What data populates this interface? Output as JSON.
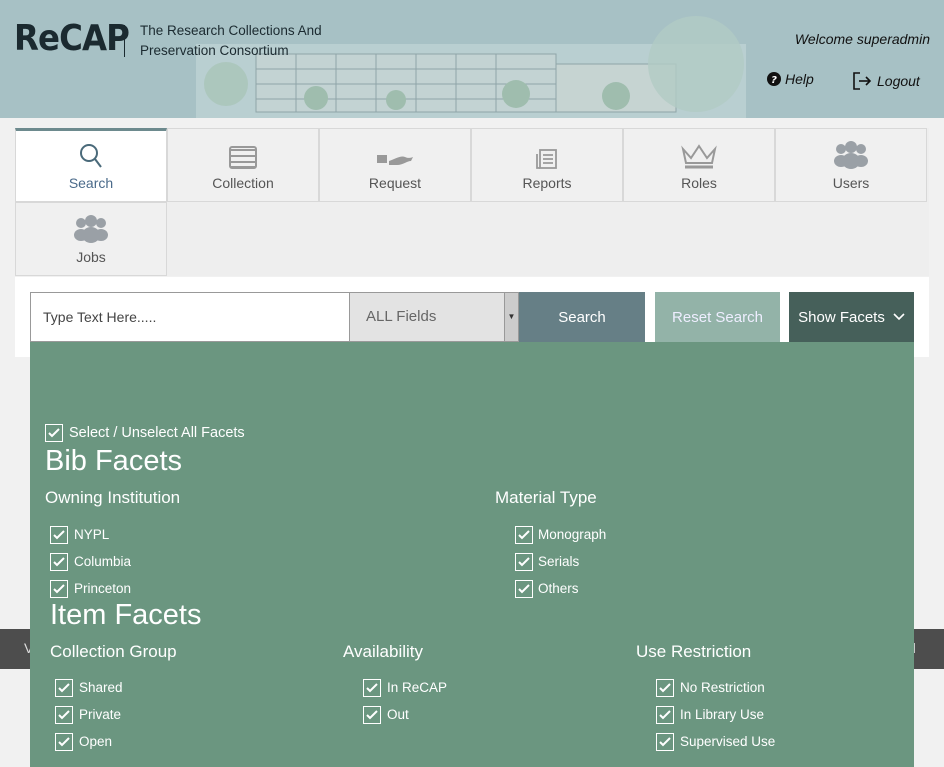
{
  "header": {
    "logo": "ReCAP",
    "tagline": "The Research Collections And Preservation Consortium",
    "welcome": "Welcome superadmin",
    "help": "Help",
    "logout": "Logout"
  },
  "tabs": [
    {
      "label": "Search",
      "icon": "search-icon",
      "active": true
    },
    {
      "label": "Collection",
      "icon": "books-icon"
    },
    {
      "label": "Request",
      "icon": "hand-book-icon"
    },
    {
      "label": "Reports",
      "icon": "document-icon"
    },
    {
      "label": "Roles",
      "icon": "crown-icon"
    },
    {
      "label": "Users",
      "icon": "users-icon"
    },
    {
      "label": "Jobs",
      "icon": "users-icon"
    }
  ],
  "search": {
    "placeholder": "Type Text Here.....",
    "field": "ALL Fields",
    "search_label": "Search",
    "reset_label": "Reset Search",
    "show_facets_label": "Show Facets"
  },
  "footer": {
    "left": "V",
    "right": "d"
  },
  "facets": {
    "select_all": "Select / Unselect All Facets",
    "bib_title": "Bib Facets",
    "owning_institution": {
      "title": "Owning Institution",
      "items": [
        "NYPL",
        "Columbia",
        "Princeton"
      ]
    },
    "material_type": {
      "title": "Material Type",
      "items": [
        "Monograph",
        "Serials",
        "Others"
      ]
    },
    "item_title": "Item Facets",
    "collection_group": {
      "title": "Collection Group",
      "items": [
        "Shared",
        "Private",
        "Open"
      ]
    },
    "availability": {
      "title": "Availability",
      "items": [
        "In ReCAP",
        "Out"
      ]
    },
    "use_restriction": {
      "title": "Use Restriction",
      "items": [
        "No Restriction",
        "In Library Use",
        "Supervised Use"
      ]
    }
  },
  "colors": {
    "header_bg": "#a7c1c5",
    "facets_bg": "#6b9680",
    "search_btn": "#667f86",
    "reset_btn": "#93b3a8",
    "show_facets_btn": "#46605a"
  }
}
